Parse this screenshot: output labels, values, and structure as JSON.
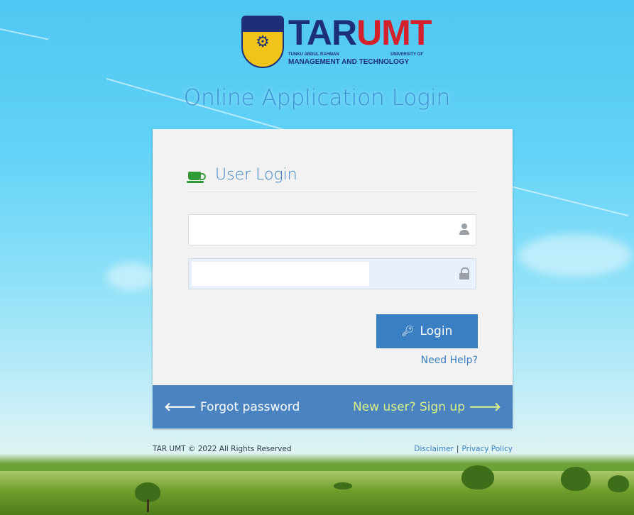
{
  "logo": {
    "crest_icon": "university-crest-icon",
    "brand_tar": "TAR",
    "brand_umt": "UMT",
    "line1_left": "TUNKU ABDUL RAHMAN",
    "line1_right": "UNIVERSITY OF",
    "line2": "MANAGEMENT AND TECHNOLOGY"
  },
  "page_title": "Online Application Login",
  "login_card": {
    "header_icon": "coffee-cup-icon",
    "header_title": "User Login",
    "username": {
      "value": "",
      "placeholder": "",
      "icon": "user-icon"
    },
    "password": {
      "value": "",
      "placeholder": "",
      "icon": "lock-icon"
    },
    "login_button": {
      "icon": "key-icon",
      "label": "Login"
    },
    "help_link": "Need Help?",
    "forgot_password": {
      "icon": "arrow-left-icon",
      "label": "Forgot password"
    },
    "signup": {
      "label": "New user? Sign up",
      "icon": "arrow-right-icon"
    }
  },
  "footer": {
    "copyright": "TAR UMT © 2022 All Rights Reserved",
    "disclaimer": "Disclaimer",
    "separator": "|",
    "privacy": "Privacy Policy"
  },
  "colors": {
    "primary_blue": "#3a7fc2",
    "footer_bar": "#4b83c1",
    "signup_text": "#d9f08a",
    "icon_green": "#2e9b36"
  }
}
